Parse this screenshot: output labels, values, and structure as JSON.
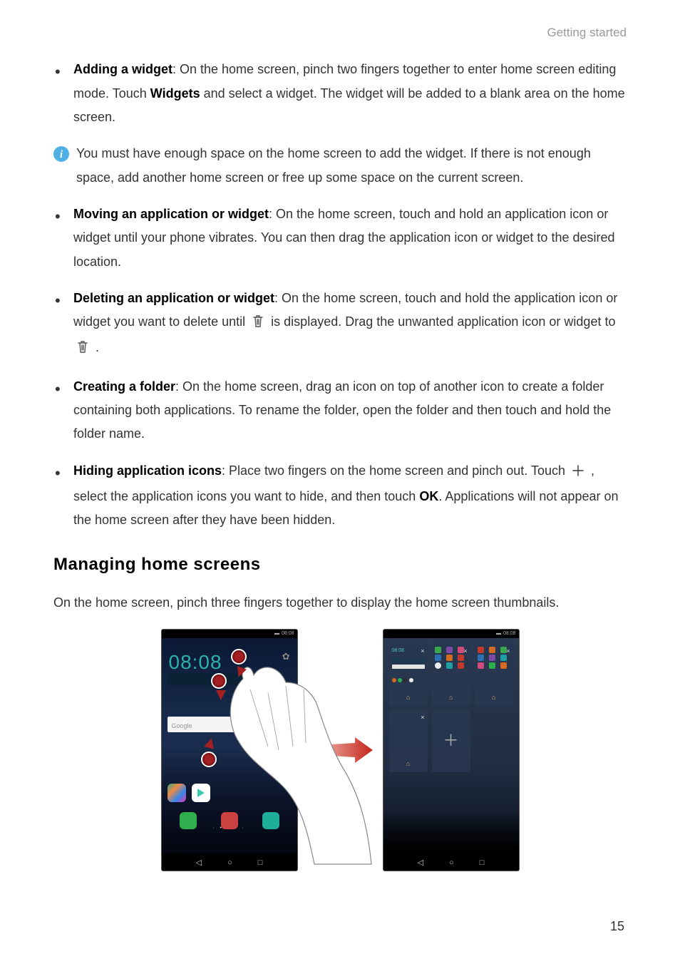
{
  "header": {
    "section_label": "Getting started"
  },
  "bullets": {
    "b1": {
      "title": "Adding a widget",
      "text_a": ": On the home screen, pinch two fingers together to enter home screen editing mode. Touch ",
      "widgets_word": "Widgets",
      "text_b": " and select a widget. The widget will be added to a blank area on the home screen."
    },
    "info": {
      "text": "You must have enough space on the home screen to add the widget. If there is not enough space, add another home screen or free up some space on the current screen."
    },
    "b2": {
      "title": "Moving an application or widget",
      "text": ": On the home screen, touch and hold an application icon or widget until your phone vibrates. You can then drag the application icon or widget to the desired location."
    },
    "b3": {
      "title": "Deleting an application or widget",
      "text_a": ": On the home screen, touch and hold the application icon or widget you want to delete until ",
      "text_b": " is displayed. Drag the unwanted application icon or widget to ",
      "text_c": " ."
    },
    "b4": {
      "title": "Creating a folder",
      "text": ": On the home screen, drag an icon on top of another icon to create a folder containing both applications. To rename the folder, open the folder and then touch and hold the folder name."
    },
    "b5": {
      "title": "Hiding application icons",
      "text_a": ": Place two fingers on the home screen and pinch out. Touch ",
      "text_b": " , select the application icons you want to hide, and then touch ",
      "ok_word": "OK",
      "text_c": ". Applications will not appear on the home screen after they have been hidden."
    }
  },
  "section_heading": "Managing home screens",
  "section_intro": "On the home screen, pinch three fingers together to display the home screen thumbnails.",
  "mock": {
    "status_time": "08:08",
    "big_time": "08:08",
    "google_label": "Google",
    "thumb_time": "08:08"
  },
  "icon_colors": {
    "tile_green": "#39a84e",
    "tile_purple": "#7d4aa6",
    "tile_pink": "#d24a7a",
    "tile_blue": "#2e6fb3",
    "tile_orange": "#d46a1f",
    "tile_red": "#c0392b",
    "tile_cyan": "#1f9ea6",
    "dock_green": "#2fae4e",
    "dock_red": "#c94141",
    "dock_teal": "#1fae9a"
  },
  "page_number": "15"
}
